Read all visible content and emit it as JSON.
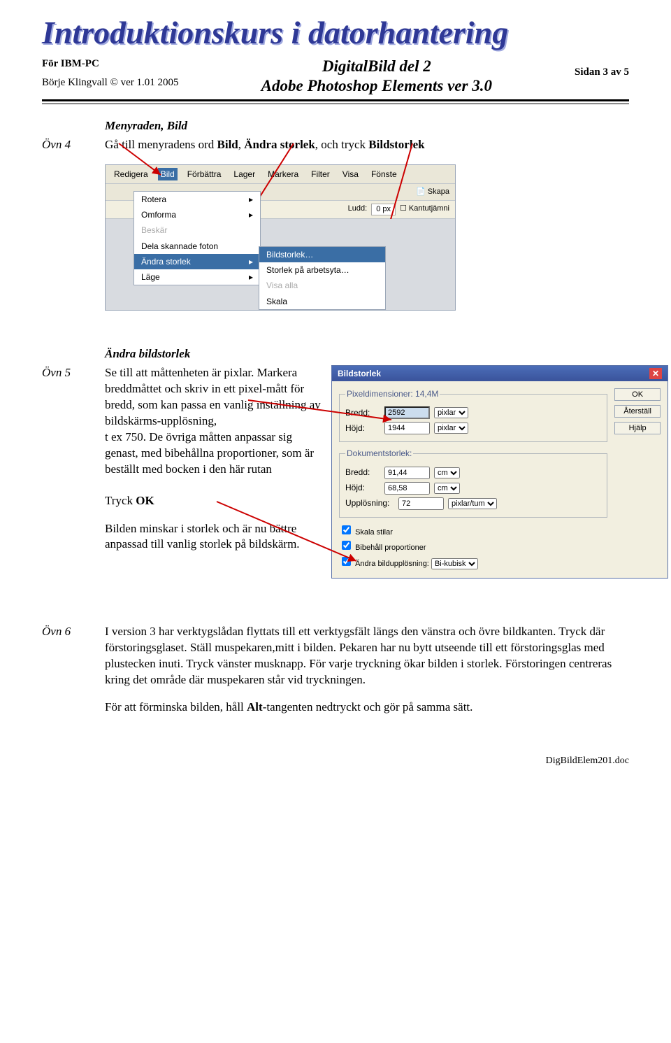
{
  "header": {
    "wordart": "Introduktionskurs i datorhantering",
    "left_line1": "För IBM-PC",
    "left_line2": "Börje Klingvall © ver 1.01 2005",
    "center_line1": "DigitalBild del 2",
    "center_line2": "Adobe Photoshop Elements ver 3.0",
    "page_of": "Sidan 3 av 5"
  },
  "section1_title": "Menyraden, Bild",
  "ovn4": {
    "label": "Övn 4",
    "text_before": "Gå till menyradens ord ",
    "bold1": "Bild",
    "mid1": ", ",
    "bold2": "Ändra storlek",
    "mid2": ", och tryck ",
    "bold3": "Bildstorlek"
  },
  "menubar": {
    "items": [
      "Redigera",
      "Bild",
      "Förbättra",
      "Lager",
      "Markera",
      "Filter",
      "Visa",
      "Fönste"
    ],
    "toolbar_skapa": "Skapa",
    "toolbar_ludd_label": "Ludd:",
    "toolbar_ludd_value": "0 px",
    "toolbar_kant": "Kantutjämni"
  },
  "dropdown": {
    "items": [
      "Rotera",
      "Omforma",
      "Beskär",
      "Dela skannade foton",
      "Ändra storlek",
      "Läge"
    ],
    "sub": [
      "Bildstorlek…",
      "Storlek på arbetsyta…",
      "Visa alla",
      "Skala"
    ]
  },
  "section2_title": "Ändra bildstorlek",
  "ovn5": {
    "label": "Övn 5",
    "para": "Se till att måttenheten är pixlar. Markera breddmåttet och skriv in ett pixel-mått för bredd, som kan passa en vanlig inställning av bildskärms-upplösning,\nt ex  750. De övriga måtten anpassar sig genast, med bibehållna proportioner, som är beställt med bocken i den här rutan",
    "tryck": "Tryck ",
    "ok": "OK",
    "result": "Bilden minskar i storlek och är nu bättre anpassad till vanlig storlek på bildskärm."
  },
  "dialog": {
    "title": "Bildstorlek",
    "pixeldim_legend": "Pixeldimensioner: 14,4M",
    "bredd_label": "Bredd:",
    "bredd_val": "2592",
    "hojd_label": "Höjd:",
    "hojd_val": "1944",
    "unit_pixlar": "pixlar",
    "doc_legend": "Dokumentstorlek:",
    "doc_bredd": "91,44",
    "doc_hojd": "68,58",
    "unit_cm": "cm",
    "uppl_label": "Upplösning:",
    "uppl_val": "72",
    "uppl_unit": "pixlar/tum",
    "btn_ok": "OK",
    "btn_reset": "Återställ",
    "btn_help": "Hjälp",
    "chk_skala": "Skala stilar",
    "chk_prop": "Bibehåll proportioner",
    "chk_andra": "Ändra bildupplösning:",
    "resample": "Bi-kubisk"
  },
  "ovn6": {
    "label": "Övn 6",
    "body": "I version 3 har verktygslådan flyttats till ett verktygsfält längs den vänstra och övre bildkanten. Tryck där förstoringsglaset. Ställ muspekaren,mitt i bilden. Pekaren har nu bytt utseende till ett förstoringsglas med plustecken inuti. Tryck vänster musknapp. För varje tryckning ökar bilden i storlek. Förstoringen centreras kring det område där muspekaren står vid tryckningen.",
    "tail_pre": "För att förminska bilden, håll ",
    "tail_bold": "Alt",
    "tail_post": "-tangenten nedtryckt och gör på samma sätt."
  },
  "footer": "DigBildElem201.doc"
}
